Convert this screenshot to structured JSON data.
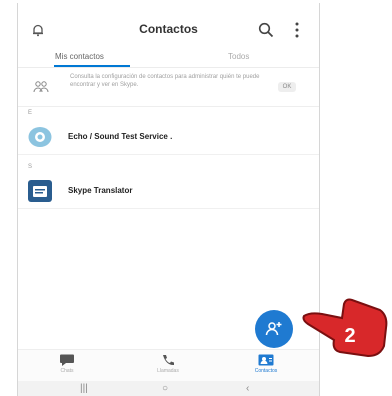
{
  "header": {
    "title": "Contactos"
  },
  "tabs": [
    {
      "label": "Mis contactos",
      "active": true
    },
    {
      "label": "Todos",
      "active": false
    }
  ],
  "banner": {
    "text": "Consulta la configuración de contactos para administrar quién te puede encontrar y ver en Skype.",
    "dismiss_label": "OK"
  },
  "sections": [
    {
      "letter": "E",
      "contacts": [
        {
          "name": "Echo / Sound Test Service ."
        }
      ]
    },
    {
      "letter": "S",
      "contacts": [
        {
          "name": "Skype Translator"
        }
      ]
    }
  ],
  "bottom_nav": [
    {
      "label": "Chats",
      "icon": "chat-icon"
    },
    {
      "label": "Llamadas",
      "icon": "phone-icon"
    },
    {
      "label": "Contactos",
      "icon": "contacts-icon",
      "active": true
    }
  ],
  "annotation": {
    "step_number": "2"
  },
  "colors": {
    "accent": "#1f7ad1",
    "annotation_red": "#d8282a",
    "translator_blue": "#2a5d8f",
    "echo_blue": "#8cc4e0"
  }
}
